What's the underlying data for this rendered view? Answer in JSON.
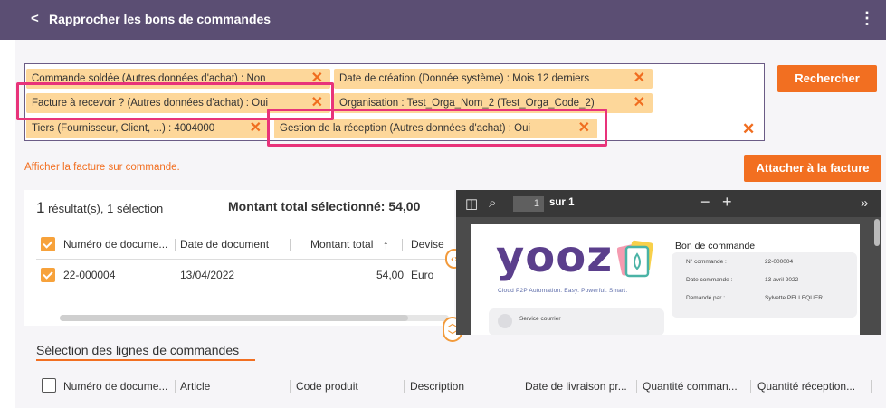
{
  "header": {
    "back_icon": "chevron-left-icon",
    "title": "Rapprocher les bons de commandes",
    "menu_icon": "kebab-menu-icon"
  },
  "filters": {
    "chips": [
      "Commande soldée (Autres données d'achat) : Non",
      "Date de création (Donnée système) : Mois 12 derniers",
      "Facture à recevoir ? (Autres données d'achat) : Oui",
      "Organisation : Test_Orga_Nom_2 (Test_Orga_Code_2)",
      "Tiers (Fournisseur, Client, ...) : 4004000",
      "Gestion de la réception (Autres données d'achat) : Oui"
    ],
    "remove_glyph": "✕",
    "clear_glyph": "✕",
    "search_label": "Rechercher",
    "chip_color": "#fdd79a",
    "highlight_color": "#e8337a"
  },
  "actions": {
    "show_invoice_link": "Afficher la facture sur commande.",
    "attach_label": "Attacher à la facture",
    "accent": "#f26f21"
  },
  "results": {
    "count": "1",
    "summary": "résultat(s), 1 sélection",
    "total": "Montant total sélectionné: 54,00",
    "columns": [
      "Numéro de docume...",
      "Date de document",
      "Montant total",
      "Devise"
    ],
    "sort_glyph": "↑",
    "rows": [
      {
        "numero": "22-000004",
        "date": "13/04/2022",
        "montant": "54,00",
        "devise": "Euro"
      }
    ]
  },
  "viewer": {
    "page": "1",
    "of_label": "sur 1",
    "minus": "−",
    "plus": "+",
    "next": "»",
    "doc": {
      "logo": "yooz",
      "tagline": "Cloud P2P Automation. Easy. Powerful. Smart.",
      "title": "Bon de commande",
      "fields": [
        {
          "label": "N° commande :",
          "value": "22-000004"
        },
        {
          "label": "Date commande :",
          "value": "13 avril 2022"
        },
        {
          "label": "Demandé par :",
          "value": "Sylvette PELLEQUER"
        }
      ],
      "service": "Service courrier"
    }
  },
  "lines": {
    "title": "Sélection des lignes de commandes",
    "columns": [
      "Numéro de docume...",
      "Article",
      "Code produit",
      "Description",
      "Date de livraison pr...",
      "Quantité comman...",
      "Quantité réception..."
    ]
  }
}
